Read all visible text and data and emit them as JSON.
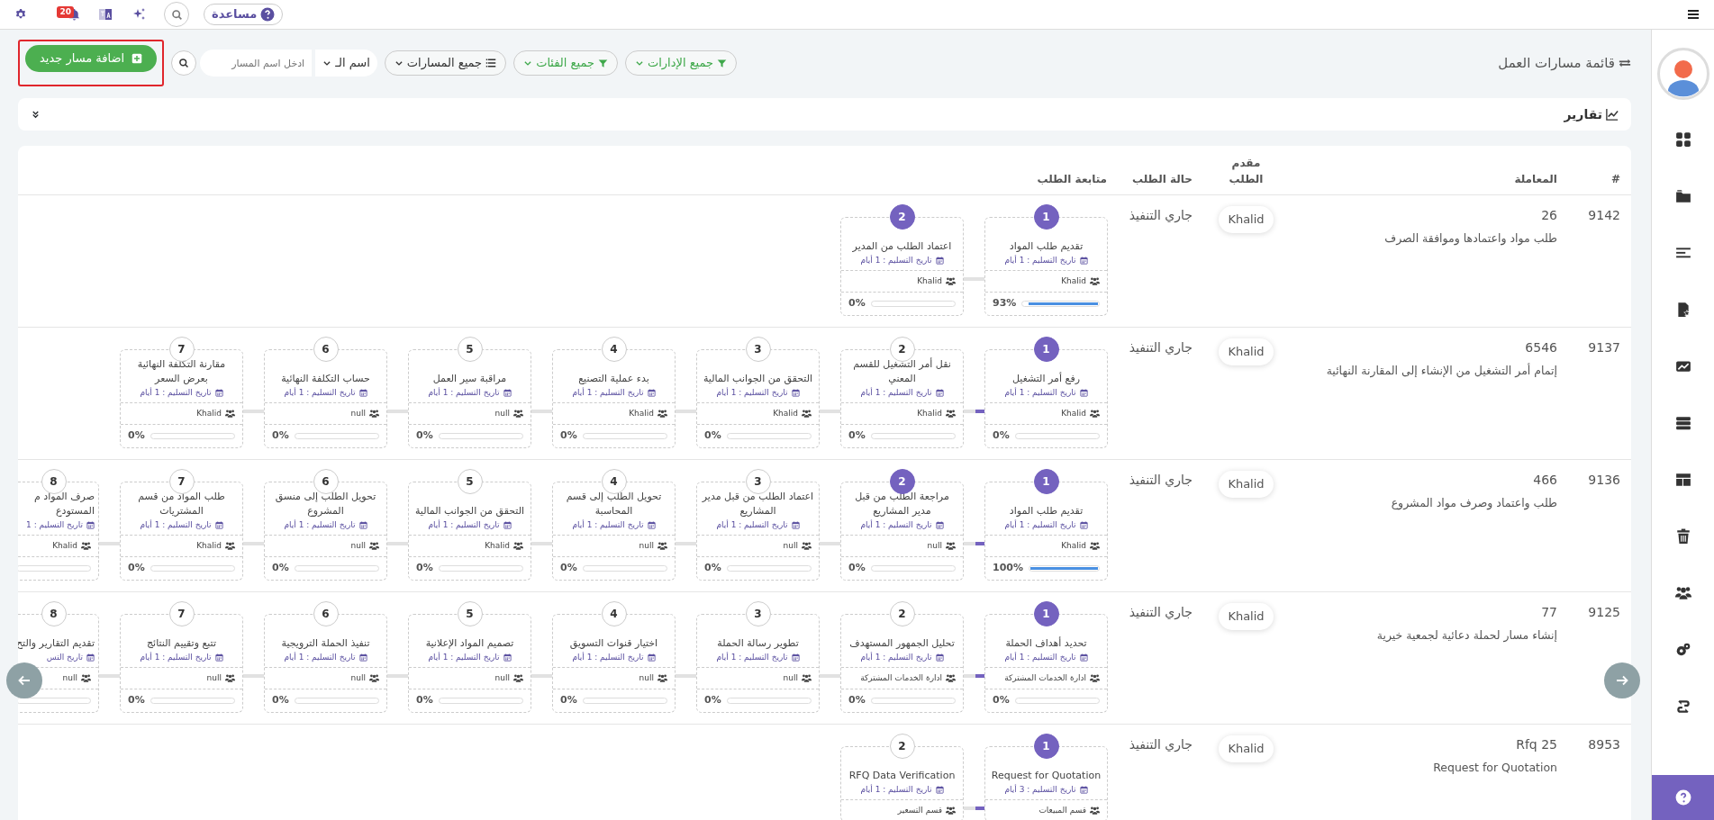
{
  "topbar": {
    "help_label": "مساعدة",
    "notification_count": "20"
  },
  "page_title": "قائمة مسارات العمل",
  "filters": [
    {
      "label": "جميع الإدارات",
      "kind": "filter"
    },
    {
      "label": "جميع الفئات",
      "kind": "filter"
    },
    {
      "label": "جميع المسارات",
      "kind": "list"
    }
  ],
  "search": {
    "field_select": "اسم الـ",
    "placeholder": "ادخل اسم المسار"
  },
  "add_button": {
    "label": "اضافة مسار جديد",
    "highlighted": true
  },
  "reports": {
    "title": "تقارير"
  },
  "table": {
    "columns": [
      "#",
      "المعاملة",
      "مقدم الطلب",
      "حالة الطلب",
      "متابعة الطلب"
    ],
    "rows": [
      {
        "id": "9142",
        "number": "26",
        "name": "طلب مواد واعتمادها وموافقة الصرف",
        "requester": "Khalid",
        "status": "جاري التنفيذ",
        "steps": [
          {
            "kind": "full",
            "number": "1",
            "title": "تقديم طلب المواد",
            "due": "تاريخ التسليم : 1 أيام",
            "owner": "Khalid",
            "percent": "93%",
            "level": 0.93,
            "active": true,
            "connector_active": false
          },
          {
            "kind": "full",
            "number": "2",
            "title": "اعتماد الطلب من المدير",
            "due": "تاريخ التسليم : 1 أيام",
            "owner": "Khalid",
            "percent": "0%",
            "level": 0,
            "active": true
          }
        ]
      },
      {
        "id": "9137",
        "number": "6546",
        "name": "إتمام أمر التشغيل من الإنشاء إلى المقارنة النهائية",
        "requester": "Khalid",
        "status": "جاري التنفيذ",
        "steps": [
          {
            "kind": "full",
            "number": "1",
            "title": "رفع أمر التشغيل",
            "due": "تاريخ التسليم : 1 أيام",
            "owner": "Khalid",
            "percent": "0%",
            "level": 0,
            "active": true,
            "connector_active": true
          },
          {
            "kind": "full",
            "number": "2",
            "title": "نقل أمر التشغيل للقسم المعني",
            "due": "تاريخ التسليم : 1 أيام",
            "owner": "Khalid",
            "percent": "0%",
            "level": 0,
            "active": false,
            "connector_active": false
          },
          {
            "kind": "full",
            "number": "3",
            "title": "التحقق من الجوانب المالية",
            "due": "تاريخ التسليم : 1 أيام",
            "owner": "Khalid",
            "percent": "0%",
            "level": 0,
            "active": false,
            "connector_active": false
          },
          {
            "kind": "full",
            "number": "4",
            "title": "بدء عملية التصنيع",
            "due": "تاريخ التسليم : 1 أيام",
            "owner": "Khalid",
            "percent": "0%",
            "level": 0,
            "active": false,
            "connector_active": false
          },
          {
            "kind": "full",
            "number": "5",
            "title": "مراقبة سير العمل",
            "due": "تاريخ التسليم : 1 أيام",
            "owner": "null",
            "percent": "0%",
            "level": 0,
            "active": false,
            "connector_active": false
          },
          {
            "kind": "full",
            "number": "6",
            "title": "حساب التكلفة النهائية",
            "due": "تاريخ التسليم : 1 أيام",
            "owner": "null",
            "percent": "0%",
            "level": 0,
            "active": false,
            "connector_active": false
          },
          {
            "kind": "full",
            "number": "7",
            "title": "مقارنة التكلفة النهائية بعرض السعر",
            "due": "تاريخ التسليم : 1 أيام",
            "owner": "Khalid",
            "percent": "0%",
            "level": 0,
            "active": false
          }
        ]
      },
      {
        "id": "9136",
        "number": "466",
        "name": "طلب واعتماد وصرف مواد المشروع",
        "requester": "Khalid",
        "status": "جاري التنفيذ",
        "steps": [
          {
            "kind": "full",
            "number": "1",
            "title": "تقديم طلب المواد",
            "due": "تاريخ التسليم : 1 أيام",
            "owner": "Khalid",
            "percent": "100%",
            "level": 1,
            "active": true,
            "connector_active": true
          },
          {
            "kind": "full",
            "number": "2",
            "title": "مراجعة الطلب من قبل مدير المشاريع",
            "due": "تاريخ التسليم : 1 أيام",
            "owner": "null",
            "percent": "0%",
            "level": 0,
            "active": true,
            "connector_active": false
          },
          {
            "kind": "full",
            "number": "3",
            "title": "اعتماد الطلب من قبل مدير المشاريع",
            "due": "تاريخ التسليم : 1 أيام",
            "owner": "null",
            "percent": "0%",
            "level": 0,
            "active": false,
            "connector_active": false
          },
          {
            "kind": "full",
            "number": "4",
            "title": "تحويل الطلب إلى قسم المحاسبة",
            "due": "تاريخ التسليم : 1 أيام",
            "owner": "null",
            "percent": "0%",
            "level": 0,
            "active": false,
            "connector_active": false
          },
          {
            "kind": "full",
            "number": "5",
            "title": "التحقق من الجوانب المالية",
            "due": "تاريخ التسليم : 1 أيام",
            "owner": "Khalid",
            "percent": "0%",
            "level": 0,
            "active": false,
            "connector_active": false
          },
          {
            "kind": "full",
            "number": "6",
            "title": "تحويل الطلب إلى منسق المشروع",
            "due": "تاريخ التسليم : 1 أيام",
            "owner": "null",
            "percent": "0%",
            "level": 0,
            "active": false,
            "connector_active": false
          },
          {
            "kind": "full",
            "number": "7",
            "title": "طلب المواد من قسم المشتريات",
            "due": "تاريخ التسليم : 1 أيام",
            "owner": "Khalid",
            "percent": "0%",
            "level": 0,
            "active": false,
            "connector_active": false
          },
          {
            "kind": "partial",
            "number": "8",
            "title": "صرف المواد م المستودع",
            "due": "تاريخ التسليم : 1",
            "owner": "Khalid",
            "level": 0,
            "active": false
          }
        ]
      },
      {
        "id": "9125",
        "number": "77",
        "name": "إنشاء مسار لحملة دعائية لجمعية خيرية",
        "requester": "Khalid",
        "status": "جاري التنفيذ",
        "steps": [
          {
            "kind": "full",
            "number": "1",
            "title": "تحديد أهداف الحملة",
            "due": "تاريخ التسليم : 1 أيام",
            "owner": "ادارة الخدمات المشتركة",
            "percent": "0%",
            "level": 0,
            "active": true,
            "connector_active": true
          },
          {
            "kind": "full",
            "number": "2",
            "title": "تحليل الجمهور المستهدف",
            "due": "تاريخ التسليم : 1 أيام",
            "owner": "ادارة الخدمات المشتركة",
            "percent": "0%",
            "level": 0,
            "active": false,
            "connector_active": false
          },
          {
            "kind": "full",
            "number": "3",
            "title": "تطوير رسالة الحملة",
            "due": "تاريخ التسليم : 1 أيام",
            "owner": "null",
            "percent": "0%",
            "level": 0,
            "active": false,
            "connector_active": false
          },
          {
            "kind": "full",
            "number": "4",
            "title": "اختيار قنوات التسويق",
            "due": "تاريخ التسليم : 1 أيام",
            "owner": "null",
            "percent": "0%",
            "level": 0,
            "active": false,
            "connector_active": false
          },
          {
            "kind": "full",
            "number": "5",
            "title": "تصميم المواد الإعلانية",
            "due": "تاريخ التسليم : 1 أيام",
            "owner": "null",
            "percent": "0%",
            "level": 0,
            "active": false,
            "connector_active": false
          },
          {
            "kind": "full",
            "number": "6",
            "title": "تنفيذ الحملة الترويجية",
            "due": "تاريخ التسليم : 1 أيام",
            "owner": "null",
            "percent": "0%",
            "level": 0,
            "active": false,
            "connector_active": false
          },
          {
            "kind": "full",
            "number": "7",
            "title": "تتبع وتقييم النتائج",
            "due": "تاريخ التسليم : 1 أيام",
            "owner": "null",
            "percent": "0%",
            "level": 0,
            "active": false,
            "connector_active": false
          },
          {
            "kind": "partial",
            "number": "8",
            "title": "تقديم التقارير والتح",
            "due": "تاريخ التس",
            "owner": "null",
            "level": 0,
            "active": false
          }
        ]
      },
      {
        "id": "8953",
        "number": "Rfq 25",
        "name": "Request for Quotation",
        "requester": "Khalid",
        "status": "جاري التنفيذ",
        "steps": [
          {
            "kind": "full",
            "number": "1",
            "title": "Request for Quotation",
            "due": "تاريخ التسليم : 3 أيام",
            "owner": "قسم المبيعات",
            "active": true,
            "connector_active": true
          },
          {
            "kind": "full",
            "number": "2",
            "title": "RFQ Data Verification",
            "due": "تاريخ التسليم : 1 أيام",
            "owner": "قسم التسعير",
            "active": false
          }
        ]
      }
    ]
  }
}
